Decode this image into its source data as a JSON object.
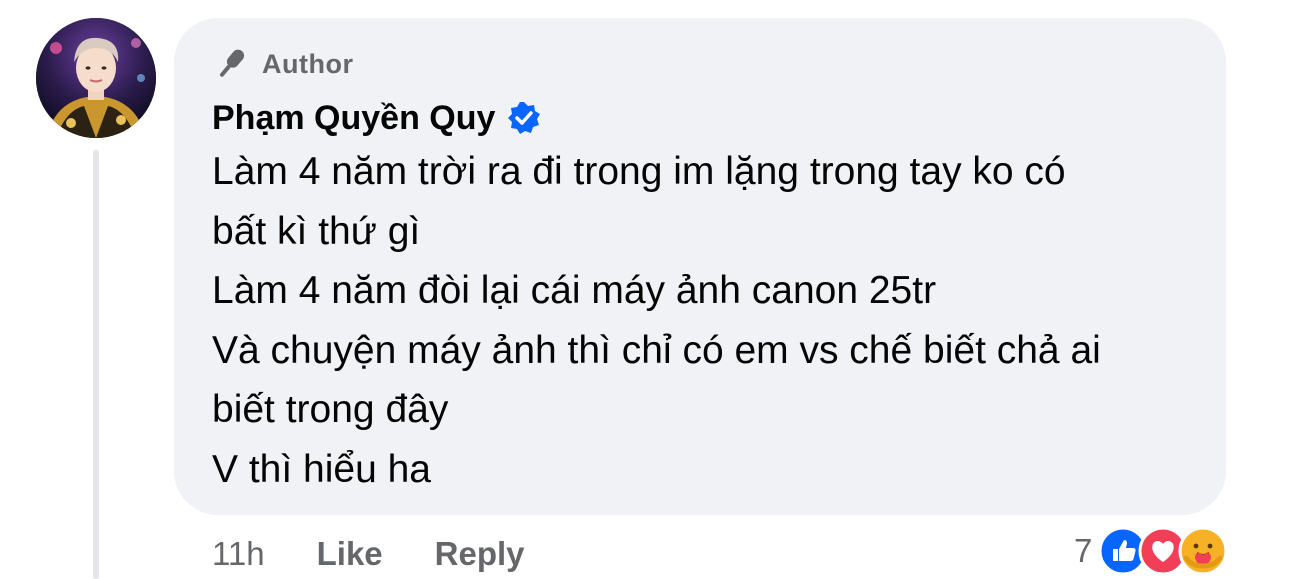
{
  "comment": {
    "badge": {
      "label": "Author",
      "icon": "microphone-icon"
    },
    "author": {
      "name": "Phạm Quyền Quy",
      "verified_icon": "verified-badge-icon"
    },
    "lines": [
      "Làm 4 năm trời ra đi trong im lặng trong tay ko có",
      "bất kì thứ gì",
      "Làm 4 năm đòi lại cái máy ảnh canon 25tr",
      "Và chuyện máy ảnh thì chỉ có em vs chế biết chả ai",
      "biết trong đây",
      "V thì hiểu ha"
    ]
  },
  "actions": {
    "time": "11h",
    "like_label": "Like",
    "reply_label": "Reply"
  },
  "reactions": {
    "count": "7",
    "icons": [
      "like-reaction-icon",
      "love-reaction-icon",
      "care-reaction-icon"
    ]
  },
  "colors": {
    "bubble": "#f0f2f5",
    "secondary_text": "#65676b",
    "verified": "#0866ff",
    "like": "#0866ff",
    "love": "#f33e58",
    "care": "#f7b125"
  }
}
